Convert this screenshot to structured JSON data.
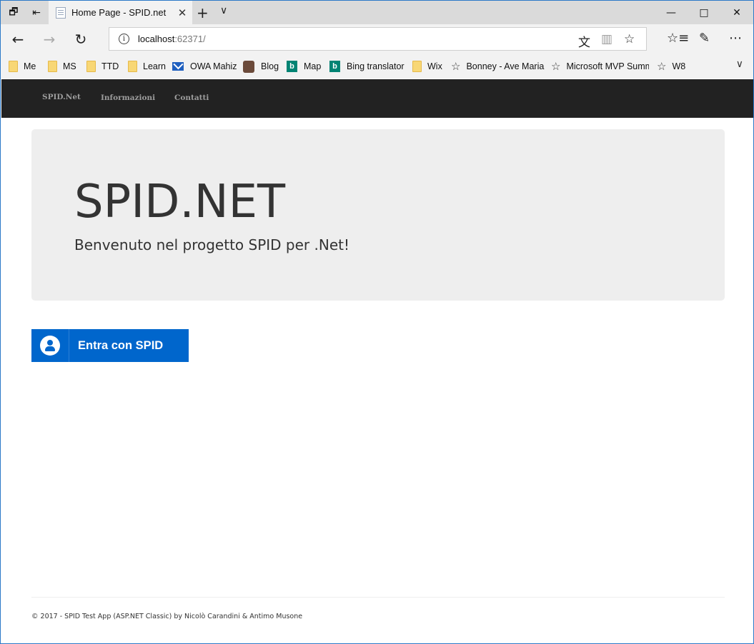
{
  "browser": {
    "tab_title": "Home Page - SPID.net",
    "address_host": "localhost",
    "address_port": ":62371/",
    "icons": {
      "tab_preview": "tab-preview-icon",
      "set_aside": "set-aside-icon",
      "close": "close-icon",
      "new_tab": "plus-icon",
      "tab_list": "chevron-down-icon",
      "back": "back-arrow-icon",
      "forward": "forward-arrow-icon",
      "refresh": "refresh-icon",
      "info": "info-icon",
      "translate": "translate-icon",
      "reading_view": "reading-view-icon",
      "favorite": "star-icon",
      "favorites_hub": "favorites-list-icon",
      "notes": "pen-icon",
      "more": "more-icon"
    },
    "favorites": [
      {
        "label": "Me",
        "icon": "folder"
      },
      {
        "label": "MS",
        "icon": "folder"
      },
      {
        "label": "TTD",
        "icon": "folder"
      },
      {
        "label": "Learn",
        "icon": "folder"
      },
      {
        "label": "OWA Mahiz",
        "icon": "mail"
      },
      {
        "label": "Blog",
        "icon": "person"
      },
      {
        "label": "Map",
        "icon": "bing"
      },
      {
        "label": "Bing translator",
        "icon": "bing"
      },
      {
        "label": "Wix",
        "icon": "folder"
      },
      {
        "label": "Bonney - Ave Maria",
        "icon": "star"
      },
      {
        "label": "Microsoft MVP Summ",
        "icon": "star"
      },
      {
        "label": "W8",
        "icon": "star"
      }
    ]
  },
  "site": {
    "nav": {
      "brand": "SPID.Net",
      "about": "Informazioni",
      "contact": "Contatti"
    },
    "jumbotron": {
      "title": "SPID.NET",
      "lead": "Benvenuto nel progetto SPID per .Net!"
    },
    "spid_button": {
      "label": "Entra con SPID",
      "color": "#0066cc"
    },
    "footer": "© 2017 - SPID Test App (ASP.NET Classic) by Nicolò Carandini & Antimo Musone"
  }
}
